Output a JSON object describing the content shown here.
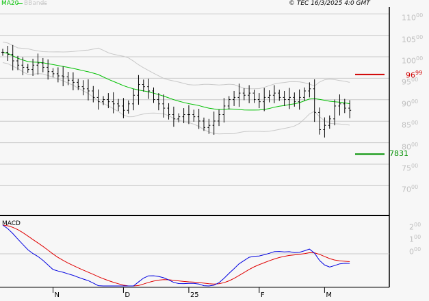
{
  "legend": {
    "ma_label": "MA20",
    "bb_label": "BBands",
    "ma_color": "#00c000",
    "bb_color": "#c8c8c8"
  },
  "copyright": "© TEC 16/3/2025 4:0 GMT",
  "chart_data": {
    "type": "ohlc",
    "title": "",
    "price_ticks": [
      {
        "v": 110,
        "int": "110",
        "dec": "00"
      },
      {
        "v": 105,
        "int": "105",
        "dec": "00"
      },
      {
        "v": 100,
        "int": "100",
        "dec": "00"
      },
      {
        "v": 95,
        "int": "95",
        "dec": "00"
      },
      {
        "v": 90,
        "int": "90",
        "dec": "00"
      },
      {
        "v": 85,
        "int": "85",
        "dec": "00"
      },
      {
        "v": 80,
        "int": "80",
        "dec": "00"
      },
      {
        "v": 75,
        "int": "75",
        "dec": "00"
      },
      {
        "v": 70,
        "int": "70",
        "dec": "00"
      }
    ],
    "ylim": [
      66,
      114
    ],
    "resistance": {
      "value": 96.99,
      "int": "96",
      "dec": "99",
      "color": "#d00000"
    },
    "support": {
      "value": 78.31,
      "label": "7831",
      "color": "#009000"
    },
    "x_labels": [
      {
        "label": "N",
        "index": 10
      },
      {
        "label": "D",
        "index": 24
      },
      {
        "label": "25",
        "index": 37
      },
      {
        "label": "F",
        "index": 51
      },
      {
        "label": "M",
        "index": 64
      }
    ],
    "closes": [
      102,
      101.5,
      100,
      99,
      98.5,
      98,
      99,
      99.5,
      98.5,
      97.5,
      97,
      96.5,
      96.3,
      95.5,
      95,
      94,
      93.5,
      93,
      91.5,
      90.5,
      91,
      90.5,
      90,
      89.5,
      88.5,
      90,
      92,
      94.5,
      94,
      93,
      91,
      90,
      89,
      87.5,
      86.5,
      87,
      87.5,
      87.5,
      87,
      86,
      84.5,
      85,
      86,
      87.5,
      89.5,
      91,
      91.5,
      92.5,
      92,
      92.5,
      91,
      90.5,
      91.5,
      92,
      92.5,
      91.5,
      91,
      91.5,
      90.5,
      91.5,
      93,
      93.5,
      88,
      84,
      85,
      86.5,
      89.5,
      90,
      89,
      88.5
    ],
    "ma_period": 20,
    "macd": {
      "label": "MACD",
      "ticks": [
        {
          "v": 2,
          "int": "2",
          "dec": "00"
        },
        {
          "v": 1,
          "int": "1",
          "dec": "00"
        },
        {
          "v": 0,
          "int": "0",
          "dec": "00"
        }
      ],
      "macd_color": "#0000e0",
      "signal_color": "#e00000"
    }
  }
}
